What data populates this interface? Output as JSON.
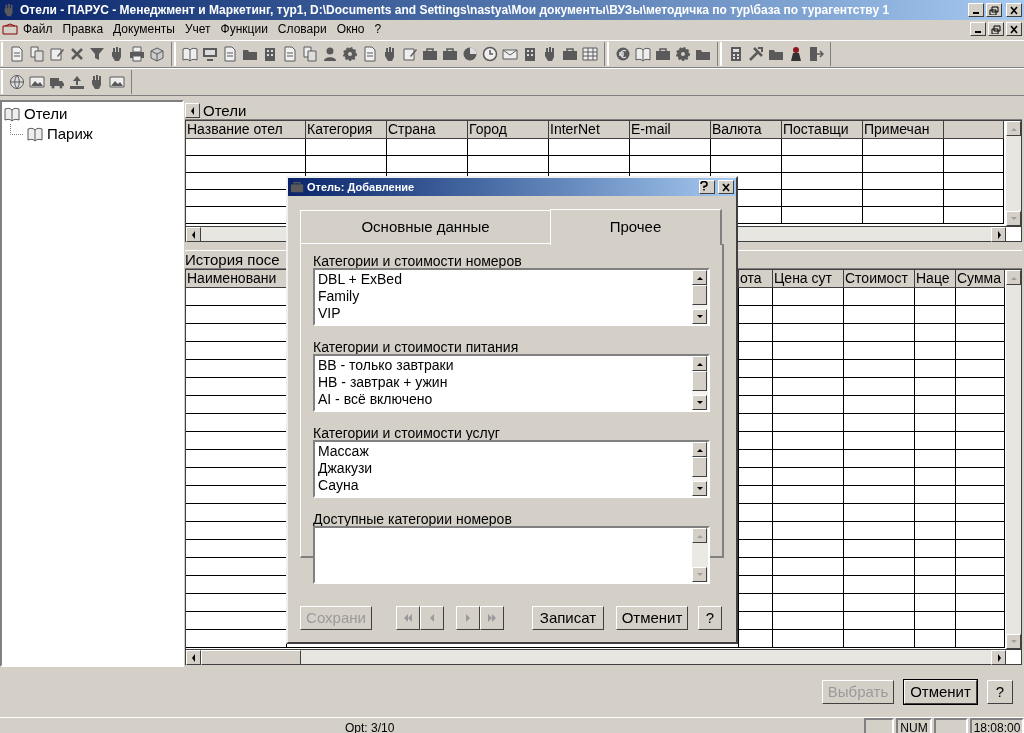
{
  "window": {
    "title": "Отели - ПАРУС - Менеджмент и Маркетинг, тур1, D:\\Documents and Settings\\nastya\\Мои документы\\ВУЗы\\методичка по тур\\база по турагентству 1"
  },
  "menu": [
    "Файл",
    "Правка",
    "Документы",
    "Учет",
    "Функции",
    "Словари",
    "Окно",
    "?"
  ],
  "tree": [
    {
      "label": "Отели",
      "children": [
        {
          "label": "Париж"
        }
      ]
    }
  ],
  "hotels_grid": {
    "title": "Отели",
    "columns": [
      "Название отел",
      "Категория",
      "Страна",
      "Город",
      "InterNet",
      "E-mail",
      "Валюта",
      "Поставщи",
      "Примечан"
    ]
  },
  "history_grid": {
    "title": "История посе",
    "columns": [
      "Наименовани",
      "ота",
      "Цена сут",
      "Стоимост",
      "Наце",
      "Сумма"
    ]
  },
  "dialog": {
    "title": "Отель: Добавление",
    "tabs": [
      {
        "label": "Основные данные",
        "selected": false
      },
      {
        "label": "Прочее",
        "selected": true
      }
    ],
    "groups": [
      {
        "label": "Категории и стоимости номеров",
        "items": [
          "DBL + ExBed",
          "Family",
          "VIP"
        ]
      },
      {
        "label": "Категории и стоимости питания",
        "items": [
          "BB - только завтраки",
          "HB - завтрак + ужин",
          "AI - всё включено"
        ]
      },
      {
        "label": "Категории и стоимости услуг",
        "items": [
          "Массаж",
          "Джакузи",
          "Сауна"
        ]
      },
      {
        "label": "Доступные категории номеров"
      }
    ],
    "buttons": [
      {
        "label": "Сохрани",
        "disabled": true
      },
      {
        "label": "Записат",
        "disabled": false
      },
      {
        "label": "Отменит",
        "disabled": false
      },
      {
        "label": "?",
        "disabled": false
      }
    ]
  },
  "footer_buttons": [
    {
      "label": "Выбрать",
      "disabled": true,
      "focused": false
    },
    {
      "label": "Отменит",
      "disabled": false,
      "focused": true
    },
    {
      "label": "?",
      "disabled": false,
      "focused": false
    }
  ],
  "status_bar": {
    "text": "Opt: 3/10",
    "num": "NUM",
    "time": "18:08:00"
  }
}
